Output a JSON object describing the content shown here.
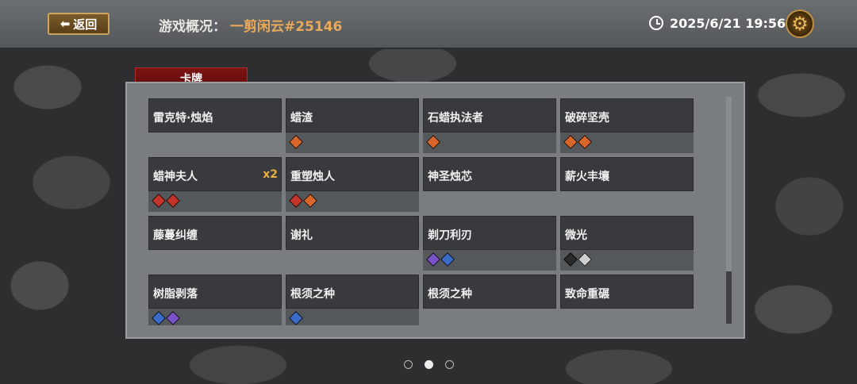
{
  "header": {
    "back_label": "返回",
    "title_label": "游戏概况：",
    "title_value": "一剪闲云#25146",
    "datetime": "2025/6/21 19:56"
  },
  "tab_label": "卡牌",
  "cards": [
    {
      "name": "雷克特·烛焰",
      "count": "",
      "gems": []
    },
    {
      "name": "蜡渣",
      "count": "",
      "gems": [
        "orange"
      ]
    },
    {
      "name": "石蜡执法者",
      "count": "",
      "gems": [
        "orange"
      ]
    },
    {
      "name": "破碎坚壳",
      "count": "",
      "gems": [
        "orange",
        "orange"
      ]
    },
    {
      "name": "蜡神夫人",
      "count": "x2",
      "gems": [
        "red",
        "red"
      ]
    },
    {
      "name": "重塑烛人",
      "count": "",
      "gems": [
        "red",
        "orange"
      ]
    },
    {
      "name": "神圣烛芯",
      "count": "",
      "gems": []
    },
    {
      "name": "薪火丰壤",
      "count": "",
      "gems": []
    },
    {
      "name": "藤蔓纠缠",
      "count": "",
      "gems": []
    },
    {
      "name": "谢礼",
      "count": "",
      "gems": []
    },
    {
      "name": "剃刀利刃",
      "count": "",
      "gems": [
        "purple",
        "blue"
      ]
    },
    {
      "name": "微光",
      "count": "",
      "gems": [
        "dark",
        "gray"
      ]
    },
    {
      "name": "树脂剥落",
      "count": "",
      "gems": [
        "blue",
        "purple"
      ]
    },
    {
      "name": "根须之种",
      "count": "",
      "gems": [
        "blue"
      ]
    },
    {
      "name": "根须之种",
      "count": "",
      "gems": []
    },
    {
      "name": "致命重碾",
      "count": "",
      "gems": []
    }
  ],
  "pagination": {
    "pages": 3,
    "active": 2
  }
}
